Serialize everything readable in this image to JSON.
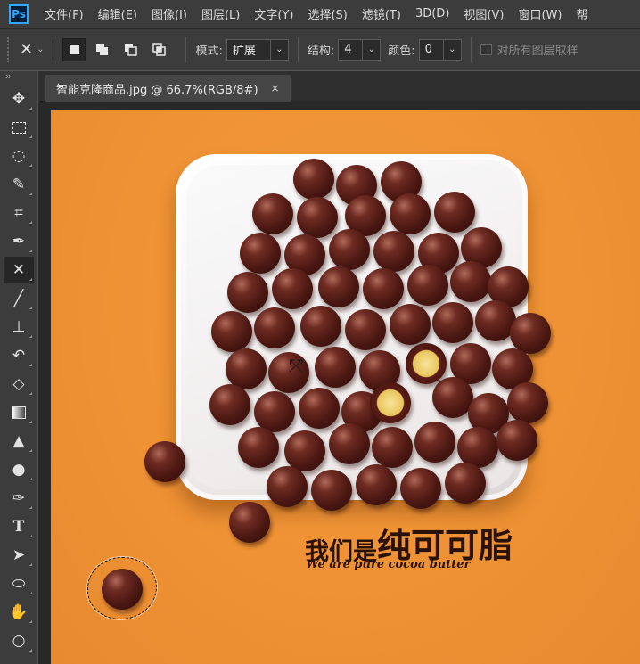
{
  "app": {
    "logo": "Ps"
  },
  "menu": [
    "文件(F)",
    "编辑(E)",
    "图像(I)",
    "图层(L)",
    "文字(Y)",
    "选择(S)",
    "滤镜(T)",
    "3D(D)",
    "视图(V)",
    "窗口(W)",
    "帮"
  ],
  "options": {
    "tool_icon": "content-aware-move-icon",
    "mode_label": "模式:",
    "mode_value": "扩展",
    "structure_label": "结构:",
    "structure_value": "4",
    "color_label": "颜色:",
    "color_value": "0",
    "sample_all_label": "对所有图层取样"
  },
  "document": {
    "tab_title": "智能克隆商品.jpg @ 66.7%(RGB/8#)",
    "close_label": "×"
  },
  "image": {
    "slogan_cn_small": "我们是",
    "slogan_cn_big": "纯可可脂",
    "slogan_en": "We are pure cocoa butter"
  },
  "tools": [
    "move",
    "marquee",
    "lasso",
    "quick-select",
    "crop",
    "eyedropper",
    "content-aware-move",
    "brush",
    "clone-stamp",
    "history-brush",
    "eraser",
    "gradient",
    "blur",
    "dodge",
    "pen",
    "type",
    "path-select",
    "ellipse",
    "hand",
    "zoom"
  ],
  "colors": {
    "canvas_orange": "#ee9134",
    "chocolate": "#4a1712",
    "ui_dark": "#3c3c3c"
  }
}
